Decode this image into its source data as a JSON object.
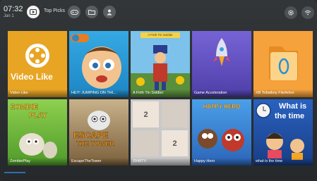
{
  "status": {
    "time": "07:32",
    "date": "Jan 1"
  },
  "top_nav": {
    "active_label": "Top Picks"
  },
  "tiles": [
    {
      "label": "Video Like",
      "art_text": "Video Like",
      "color": "#e8a524"
    },
    {
      "label": "HEY! JUMPING ON THI...",
      "color": "#2aa6e0"
    },
    {
      "label": "A Firth Tin Soldier",
      "banner": "A Firth Tin Soldier",
      "color": "#6bb8e8"
    },
    {
      "label": "Game Acceleration",
      "color": "#6b57c4"
    },
    {
      "label": "XB Tobaiboy FileArbre",
      "color": "#f5a13c"
    },
    {
      "label": "ZombiePlay",
      "art_text_1": "ZOMBIE",
      "art_text_2": "PLAY",
      "color": "#6bbf3a"
    },
    {
      "label": "EscapeTheTower",
      "art_text_1": "ESCAPE",
      "art_text_2": "THE TOWER",
      "color": "#8a6a42"
    },
    {
      "label": "2048TV",
      "cells": [
        "2",
        "",
        "",
        "2"
      ],
      "color": "#c9c9c9"
    },
    {
      "label": "Happy Hero",
      "art_text": "HAPPY HERO",
      "color": "#3a7fd6"
    },
    {
      "label": "what is the time",
      "art_text_1": "What is",
      "art_text_2": "the time",
      "color": "#2050a8"
    }
  ]
}
